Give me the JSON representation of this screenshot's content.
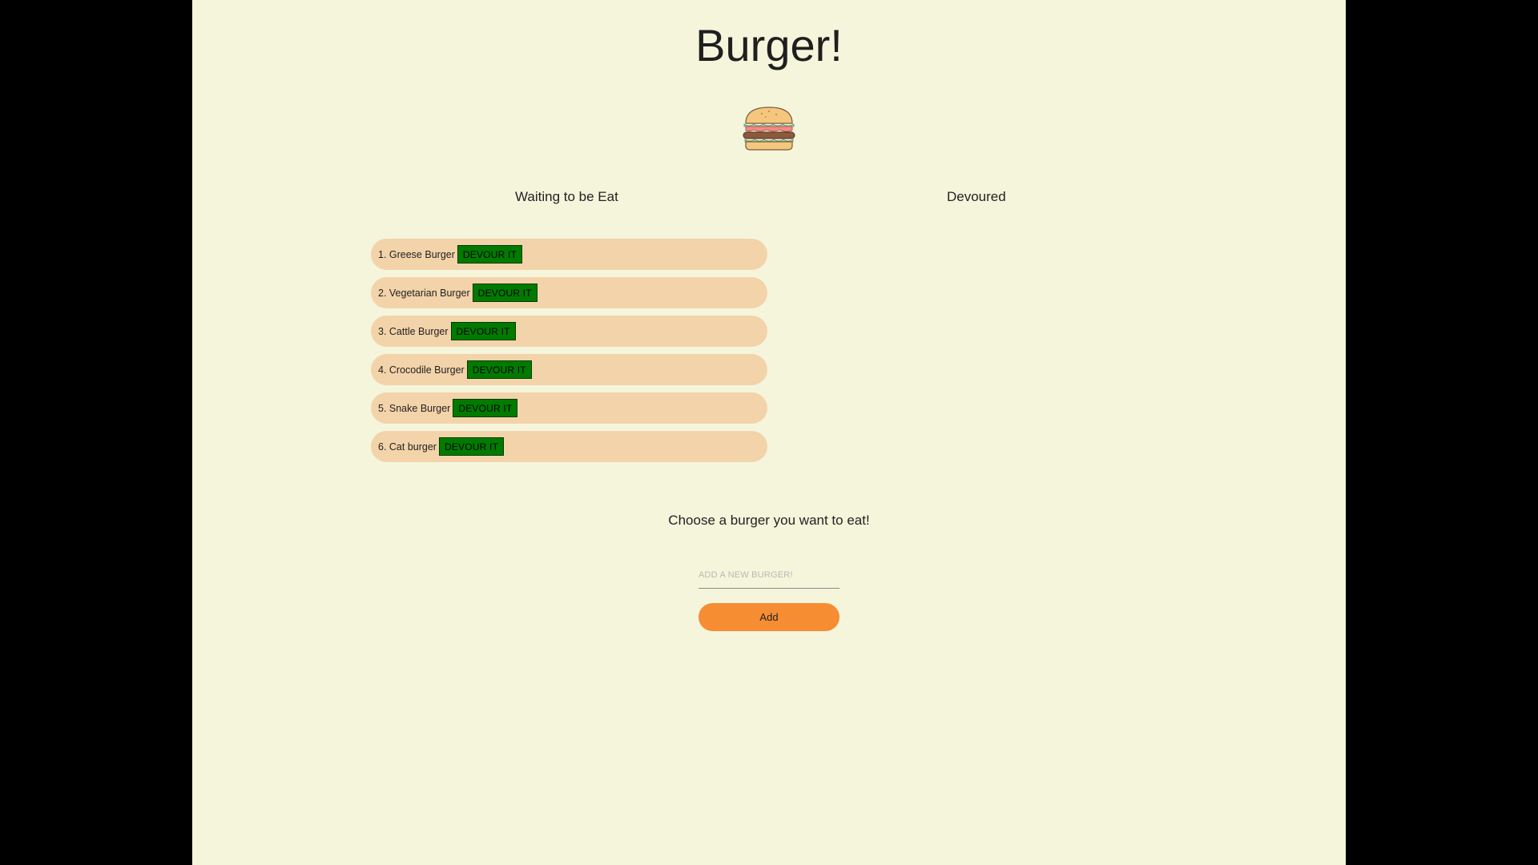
{
  "header": {
    "title": "Burger!"
  },
  "icons": {
    "logo": "burger-icon"
  },
  "columns": {
    "waiting_label": "Waiting to be Eat",
    "devoured_label": "Devoured"
  },
  "burgers": [
    {
      "name": "1. Greese Burger",
      "button_label": "DEVOUR IT"
    },
    {
      "name": "2. Vegetarian Burger",
      "button_label": "DEVOUR IT"
    },
    {
      "name": "3. Cattle Burger",
      "button_label": "DEVOUR IT"
    },
    {
      "name": "4. Crocodile Burger",
      "button_label": "DEVOUR IT"
    },
    {
      "name": "5. Snake Burger",
      "button_label": "DEVOUR IT"
    },
    {
      "name": "6. Cat burger",
      "button_label": "DEVOUR IT"
    }
  ],
  "devoured": [],
  "form": {
    "prompt": "Choose a burger you want to eat!",
    "input_value": "",
    "input_placeholder": "ADD A NEW BURGER!",
    "add_label": "Add"
  },
  "colors": {
    "page_background": "#f5f5dc",
    "outer_background": "#000000",
    "item_background": "#f3d3a9",
    "devour_button": "#007b00",
    "add_button": "#f68d32"
  }
}
